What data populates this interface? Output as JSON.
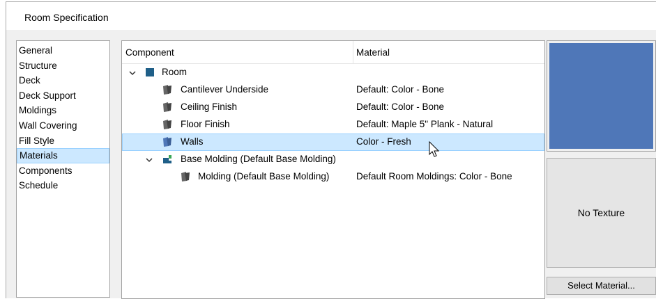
{
  "dialog": {
    "title": "Room Specification"
  },
  "nav": {
    "items": [
      {
        "label": "General"
      },
      {
        "label": "Structure"
      },
      {
        "label": "Deck"
      },
      {
        "label": "Deck Support"
      },
      {
        "label": "Moldings"
      },
      {
        "label": "Wall Covering"
      },
      {
        "label": "Fill Style"
      },
      {
        "label": "Materials",
        "selected": true
      },
      {
        "label": "Components"
      },
      {
        "label": "Schedule"
      }
    ]
  },
  "tree": {
    "columns": {
      "component": "Component",
      "material": "Material"
    },
    "rows": [
      {
        "component": "Room",
        "material": "",
        "level": 0,
        "expanded": true,
        "icon": "room-square-icon"
      },
      {
        "component": "Cantilever Underside",
        "material": "Default: Color - Bone",
        "level": 1,
        "icon": "material-swatch-icon"
      },
      {
        "component": "Ceiling Finish",
        "material": "Default: Color - Bone",
        "level": 1,
        "icon": "material-swatch-icon"
      },
      {
        "component": "Floor Finish",
        "material": "Default: Maple 5\" Plank - Natural",
        "level": 1,
        "icon": "material-swatch-icon"
      },
      {
        "component": "Walls",
        "material": "Color - Fresh",
        "level": 1,
        "icon": "material-swatch-icon",
        "selected": true
      },
      {
        "component": "Base Molding (Default Base Molding)",
        "material": "",
        "level": 1,
        "expanded": true,
        "icon": "molding-icon"
      },
      {
        "component": "Molding (Default Base Molding)",
        "material": "Default Room Moldings: Color - Bone",
        "level": 2,
        "icon": "material-swatch-icon"
      }
    ]
  },
  "preview": {
    "swatch_color": "#4f77b8",
    "texture_label": "No Texture",
    "select_button": "Select Material..."
  }
}
